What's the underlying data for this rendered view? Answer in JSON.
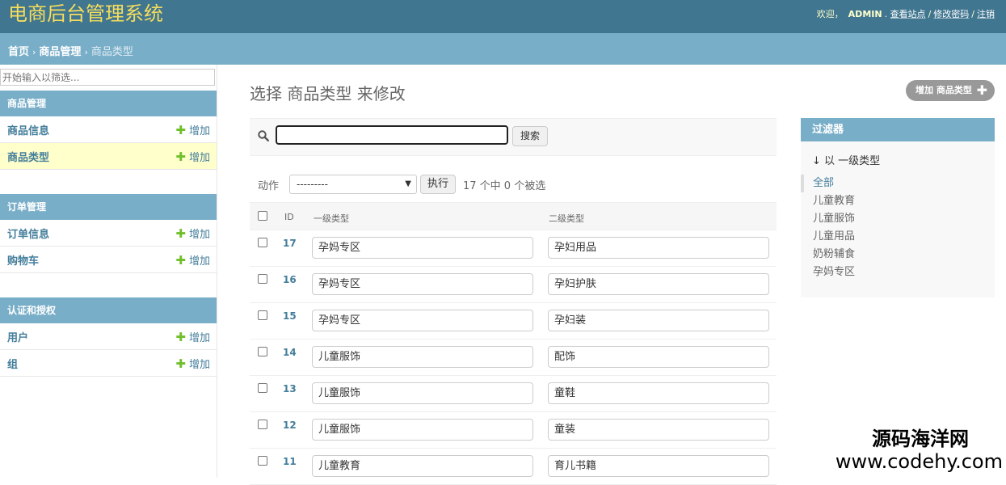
{
  "header": {
    "brand": "电商后台管理系统",
    "welcome": "欢迎，",
    "username": "ADMIN",
    "dot": ".",
    "view_site": "查看站点",
    "change_password": "修改密码",
    "logout": "注销",
    "separator": "/"
  },
  "breadcrumb": {
    "home": "首页",
    "app": "商品管理",
    "current": "商品类型",
    "arrow": "›"
  },
  "sidebar": {
    "filter_placeholder": "开始输入以筛选...",
    "add_label": "增加",
    "modules": [
      {
        "caption": "商品管理",
        "items": [
          {
            "name": "商品信息"
          },
          {
            "name": "商品类型"
          }
        ]
      },
      {
        "caption": "订单管理",
        "items": [
          {
            "name": "订单信息"
          },
          {
            "name": "购物车"
          }
        ]
      },
      {
        "caption": "认证和授权",
        "items": [
          {
            "name": "用户"
          },
          {
            "name": "组"
          }
        ]
      }
    ]
  },
  "content": {
    "title": "选择 商品类型 来修改",
    "add_button": "增加 商品类型",
    "search_button": "搜索",
    "action_label": "动作",
    "action_selected": "---------",
    "run_button": "执行",
    "selection_count": "17 个中 0 个被选"
  },
  "table": {
    "headers": {
      "id": "ID",
      "primary": "一级类型",
      "secondary": "二级类型"
    },
    "rows": [
      {
        "id": "17",
        "primary": "孕妈专区",
        "secondary": "孕妇用品"
      },
      {
        "id": "16",
        "primary": "孕妈专区",
        "secondary": "孕妇护肤"
      },
      {
        "id": "15",
        "primary": "孕妈专区",
        "secondary": "孕妇装"
      },
      {
        "id": "14",
        "primary": "儿童服饰",
        "secondary": "配饰"
      },
      {
        "id": "13",
        "primary": "儿童服饰",
        "secondary": "童鞋"
      },
      {
        "id": "12",
        "primary": "儿童服饰",
        "secondary": "童装"
      },
      {
        "id": "11",
        "primary": "儿童教育",
        "secondary": "育儿书籍"
      }
    ]
  },
  "filter": {
    "caption": "过滤器",
    "title": "↓ 以 一级类型",
    "options": [
      "全部",
      "儿童教育",
      "儿童服饰",
      "儿童用品",
      "奶粉辅食",
      "孕妈专区"
    ]
  },
  "watermark": {
    "line1": "源码海洋网",
    "line2": "www.codehy.com"
  },
  "colors": {
    "header_bg": "#417690",
    "brand": "#f5dd5d",
    "caption_bg": "#79aec8",
    "link": "#447e9b",
    "active_row": "#ffffcc",
    "add_plus": "#70bf2b"
  }
}
